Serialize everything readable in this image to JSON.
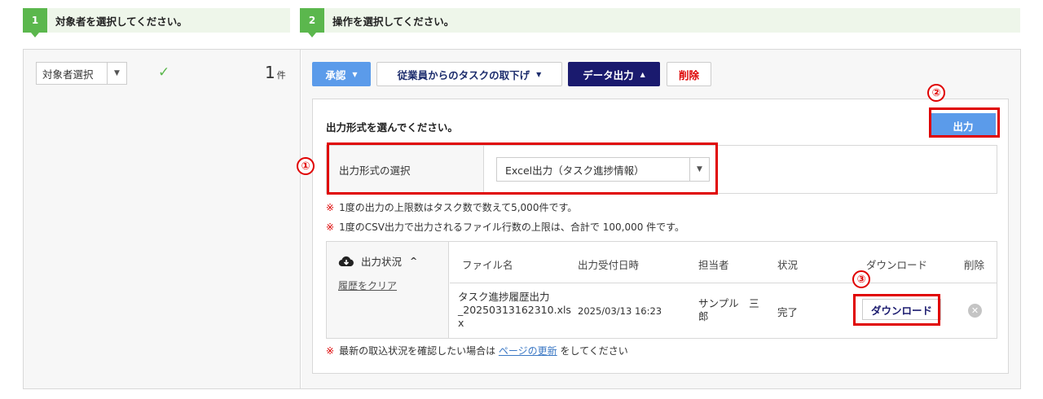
{
  "steps": [
    {
      "num": "1",
      "label": "対象者を選択してください。"
    },
    {
      "num": "2",
      "label": "操作を選択してください。"
    }
  ],
  "left": {
    "select_label": "対象者選択",
    "count": "1",
    "count_unit": "件"
  },
  "actions": {
    "approve": "承認",
    "withdraw": "従業員からのタスクの取下げ",
    "export": "データ出力",
    "delete": "削除"
  },
  "export_panel": {
    "title": "出力形式を選んでください。",
    "output_button": "出力",
    "format_label": "出力形式の選択",
    "format_value": "Excel出力（タスク進捗情報）",
    "note1": "1度の出力の上限数はタスク数で数えて5,000件です。",
    "note2": "1度のCSV出力で出力されるファイル行数の上限は、合計で 100,000 件です。",
    "note_mark": "※"
  },
  "history": {
    "status_label": "出力状況",
    "clear_link": "履歴をクリア",
    "columns": [
      "ファイル名",
      "出力受付日時",
      "担当者",
      "状況",
      "ダウンロード",
      "削除"
    ],
    "rows": [
      {
        "file_name_line1": "タスク進捗履歴出力",
        "file_name_line2": "_20250313162310.xls",
        "file_name_line3": "x",
        "received_at": "2025/03/13 16:23",
        "owner_line1": "サンプル　三",
        "owner_line2": "郎",
        "status": "完了",
        "download": "ダウンロード"
      }
    ]
  },
  "footer_note": {
    "before": "最新の取込状況を確認したい場合は ",
    "link": "ページの更新",
    "after": " をしてください"
  },
  "callouts": [
    "①",
    "②",
    "③"
  ],
  "colors": {
    "step_green": "#5bb74d",
    "primary_blue": "#5b9bea",
    "navy": "#1a1a6e",
    "highlight_red": "#e00000"
  }
}
